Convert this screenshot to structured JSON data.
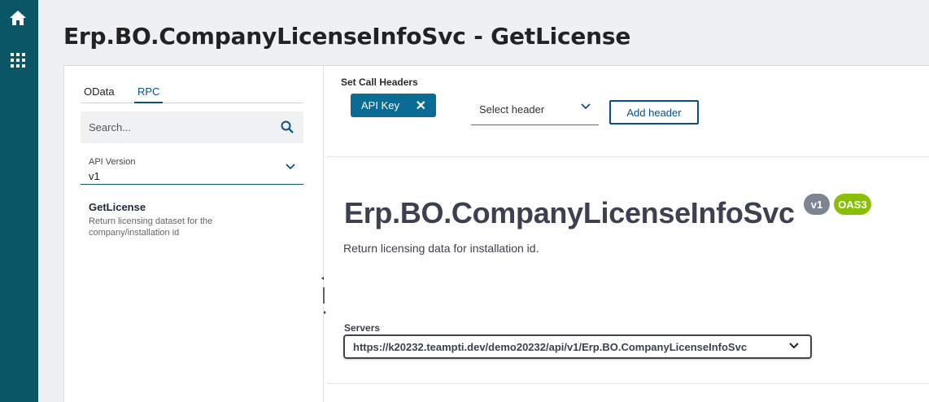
{
  "nav": {
    "home_icon": "home-icon",
    "apps_icon": "grid-icon"
  },
  "page": {
    "title": "Erp.BO.CompanyLicenseInfoSvc - GetLicense"
  },
  "sidebar": {
    "tabs": [
      {
        "label": "OData",
        "active": false
      },
      {
        "label": "RPC",
        "active": true
      }
    ],
    "search": {
      "placeholder": "Search...",
      "value": ""
    },
    "api_version": {
      "label": "API Version",
      "value": "v1"
    },
    "operations": [
      {
        "name": "GetLicense",
        "description": "Return licensing dataset for the company/installation id"
      }
    ]
  },
  "call_headers": {
    "title": "Set Call Headers",
    "chips": [
      {
        "label": "API Key",
        "close": "✕"
      }
    ],
    "select": {
      "value": "Select header"
    },
    "add_button": "Add header"
  },
  "service": {
    "title": "Erp.BO.CompanyLicenseInfoSvc",
    "version_badge": "v1",
    "spec_badge": "OAS3",
    "description": "Return licensing data for installation id.",
    "servers_label": "Servers",
    "server_url": "https://k20232.teampti.dev/demo20232/api/v1/Erp.BO.CompanyLicenseInfoSvc"
  },
  "colors": {
    "rail": "#0a5566",
    "accent": "#0a6b94",
    "badge_version": "#7d8492",
    "badge_oas": "#89bf04"
  }
}
